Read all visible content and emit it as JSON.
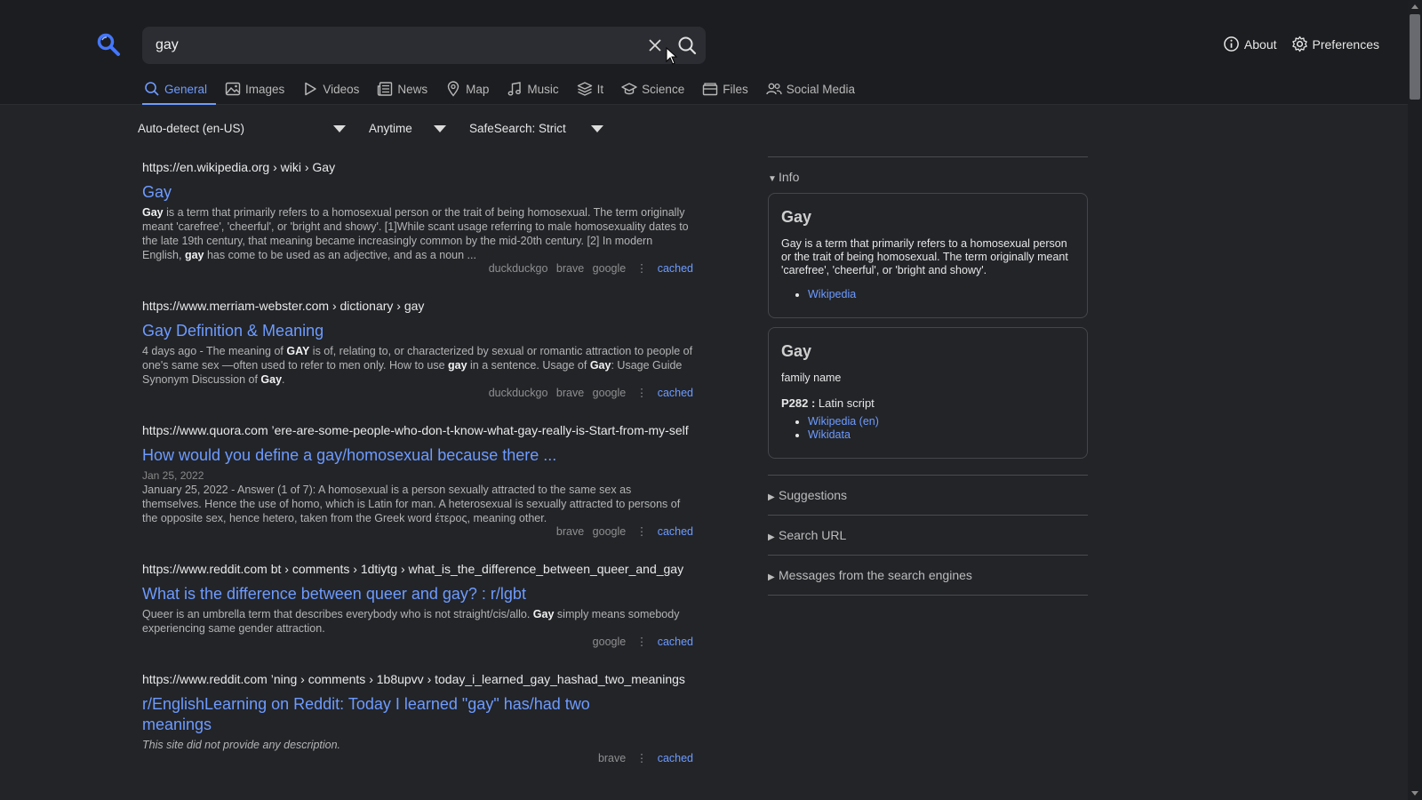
{
  "search": {
    "query": "gay"
  },
  "header": {
    "about_label": "About",
    "preferences_label": "Preferences"
  },
  "tabs": [
    {
      "label": "General",
      "icon": "search-icon"
    },
    {
      "label": "Images",
      "icon": "image-icon"
    },
    {
      "label": "Videos",
      "icon": "play-icon"
    },
    {
      "label": "News",
      "icon": "newspaper-icon"
    },
    {
      "label": "Map",
      "icon": "map-pin-icon"
    },
    {
      "label": "Music",
      "icon": "music-icon"
    },
    {
      "label": "It",
      "icon": "layers-icon"
    },
    {
      "label": "Science",
      "icon": "graduation-cap-icon"
    },
    {
      "label": "Files",
      "icon": "folder-icon"
    },
    {
      "label": "Social Media",
      "icon": "users-icon"
    }
  ],
  "filters": {
    "language": "Auto-detect (en-US)",
    "time": "Anytime",
    "safesearch": "SafeSearch: Strict"
  },
  "results": [
    {
      "url": "https://en.wikipedia.org  › wiki › Gay",
      "title": "Gay",
      "date": "",
      "snippet_html": "<b>Gay</b> is a term that primarily refers to a homosexual person or the trait of being homosexual. The term originally meant 'carefree', 'cheerful', or 'bright and showy'. [1]While scant usage referring to male homosexuality dates to the late 19th century, that meaning became increasingly common by the mid-20th century. [2] In modern English, <b>gay</b> has come to be used as an adjective, and as a noun ...",
      "engines": [
        "duckduckgo",
        "brave",
        "google"
      ],
      "cached": "cached"
    },
    {
      "url": "https://www.merriam-webster.com  › dictionary › gay",
      "title": "Gay Definition & Meaning",
      "date": "",
      "snippet_html": "4 days ago - The meaning of <b>GAY</b> is of, relating to, or characterized by sexual or romantic attraction to people of one's same sex —often used to refer to men only. How to use <b>gay</b> in a sentence. Usage of <b>Gay</b>: Usage Guide Synonym Discussion of <b>Gay</b>.",
      "engines": [
        "duckduckgo",
        "brave",
        "google"
      ],
      "cached": "cached"
    },
    {
      "url": "https://www.quora.com  ’ere-are-some-people-who-don-t-know-what-gay-really-is-Start-from-my-self",
      "title": "How would you define a gay/homosexual because there ...",
      "date": "Jan 25, 2022",
      "snippet_html": "January 25, 2022 - Answer (1 of 7): A homosexual is a person sexually attracted to the same sex as themselves. Hence the use of homo, which is Latin for man. A heterosexual is sexually attracted to persons of the opposite sex, hence hetero, taken from the Greek word έτερος, meaning other.",
      "engines": [
        "brave",
        "google"
      ],
      "cached": "cached"
    },
    {
      "url": "https://www.reddit.com  bt › comments › 1dtiytg › what_is_the_difference_between_queer_and_gay",
      "title": "What is the difference between queer and gay? : r/lgbt",
      "date": "",
      "snippet_html": "Queer is an umbrella term that describes everybody who is not straight/cis/allo. <b>Gay</b> simply means somebody experiencing same gender attraction.",
      "engines": [
        "google"
      ],
      "cached": "cached"
    },
    {
      "url": "https://www.reddit.com  ’ning › comments › 1b8upvv › today_i_learned_gay_hashad_two_meanings",
      "title": "r/EnglishLearning on Reddit: Today I learned \"gay\" has/had two meanings",
      "date": "",
      "snippet_html": "<i>This site did not provide any description.</i>",
      "engines": [
        "brave"
      ],
      "cached": "cached"
    }
  ],
  "sidebar": {
    "info_label": "Info",
    "card1": {
      "title": "Gay",
      "text": "Gay is a term that primarily refers to a homosexual person or the trait of being homosexual. The term originally meant 'carefree', 'cheerful', or 'bright and showy'.",
      "links": [
        "Wikipedia"
      ]
    },
    "card2": {
      "title": "Gay",
      "subtitle": "family name",
      "attr_key": "P282 :",
      "attr_value": " Latin script",
      "links": [
        "Wikipedia (en)",
        "Wikidata"
      ]
    },
    "suggestions_label": "Suggestions",
    "search_url_label": "Search URL",
    "messages_label": "Messages from the search engines"
  },
  "colors": {
    "accent": "#6e9bff",
    "background": "#222428",
    "header": "#1c1d20"
  }
}
